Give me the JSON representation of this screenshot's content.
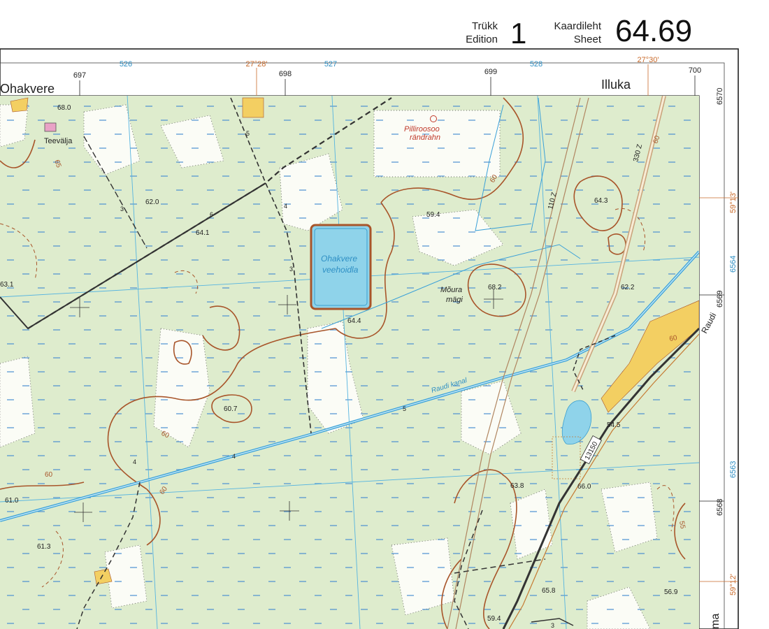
{
  "header": {
    "edition_label_et": "Trükk",
    "edition_label_en": "Edition",
    "edition_number": "1",
    "sheet_label_et": "Kaardileht",
    "sheet_label_en": "Sheet",
    "sheet_number": "64.69"
  },
  "frame": {
    "top_coords_blue": [
      "526",
      "527",
      "528"
    ],
    "top_coords_orange": [
      "27°28'",
      "27°30'"
    ],
    "top_grid_black": [
      "697",
      "698",
      "699",
      "700"
    ],
    "right_grid_black": [
      "6570",
      "6569",
      "6568"
    ],
    "right_coords_blue": [
      "6564",
      "6563"
    ],
    "right_coords_orange": [
      "59°13'",
      "59°12'"
    ]
  },
  "places": {
    "ohakvere": "Ohakvere",
    "illuka": "Illuka",
    "teevalja": "Teevälja",
    "pilliroosoo_1": "Pilliroosoo",
    "pilliroosoo_2": "rändrahn",
    "lake_1": "Ohakvere",
    "lake_2": "veehoidla",
    "moura_1": "Mõura",
    "moura_2": "mägi",
    "canal": "Raudi kanal",
    "raudi": "Raudi",
    "road_number": "13150",
    "bottom_right": "ma"
  },
  "elevations": [
    "68.0",
    "62.0",
    "64.1",
    "63.1",
    "59.4",
    "64.4",
    "68.2",
    "64.3",
    "62.2",
    "60.7",
    "61.0",
    "61.3",
    "54.5",
    "63.8",
    "66.0",
    "65.8",
    "59.4",
    "56.9"
  ],
  "contours": [
    "65",
    "60",
    "60",
    "60",
    "60",
    "60",
    "60",
    "55"
  ],
  "road_marks": [
    "330 Z",
    "110 Z"
  ],
  "misc_numbers": [
    "3",
    "4",
    "5",
    "6",
    "3",
    "4",
    "5",
    "4",
    "3"
  ],
  "colors": {
    "forest": "#deeccd",
    "open": "#fbfcf6",
    "water": "#8fd3ea",
    "grid": "#56b4e0",
    "contour": "#a8552a",
    "sand": "#f3cf62",
    "road": "#333333"
  }
}
